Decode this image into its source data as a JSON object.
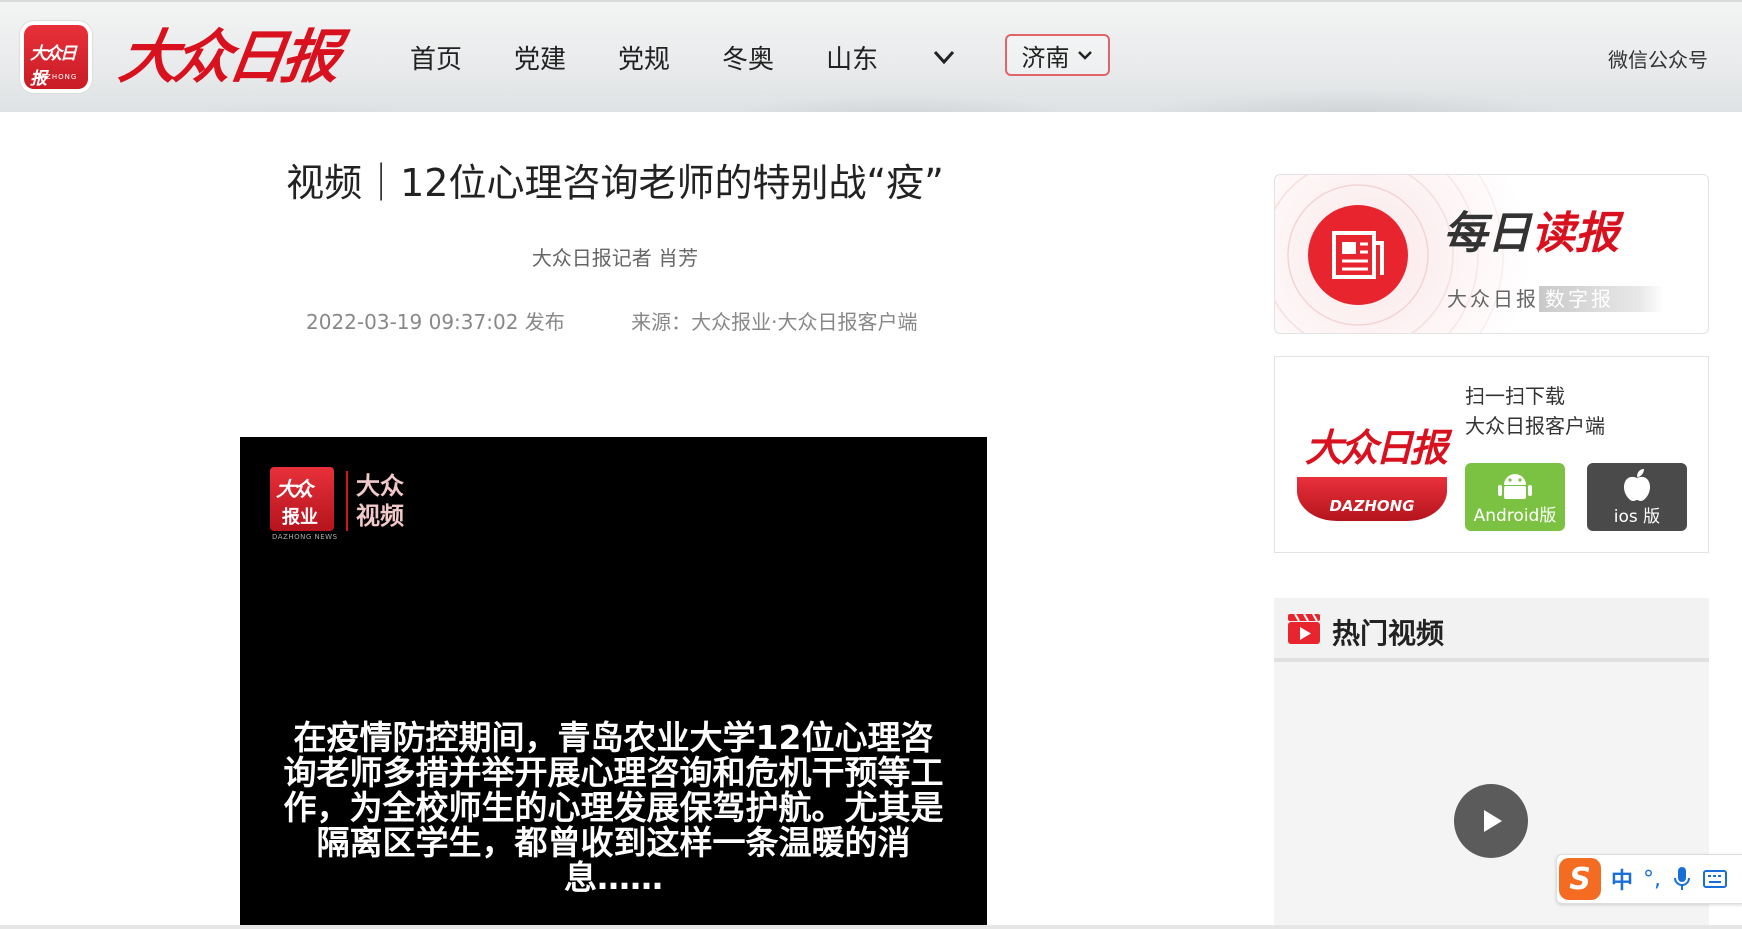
{
  "header": {
    "app_logo_text": "大众日报",
    "app_logo_sub": "DAZHONG",
    "brand": "大众日报",
    "nav": [
      "首页",
      "党建",
      "党规",
      "冬奥",
      "山东"
    ],
    "region": "济南",
    "wechat": "微信公众号"
  },
  "article": {
    "title": "视频｜12位心理咨询老师的特别战“疫”",
    "byline": "大众日报记者 肖芳",
    "published": "2022-03-19 09:37:02 发布",
    "source": "来源：大众报业·大众日报客户端"
  },
  "video": {
    "logo_top": "大众",
    "logo_bottom": "报业",
    "logo_caption": "DAZHONG NEWS",
    "channel": "大众视频",
    "subtitle": "在疫情防控期间，青岛农业大学12位心理咨询老师多措并举开展心理咨询和危机干预等工作，为全校师生的心理发展保驾护航。尤其是隔离区学生，都曾收到这样一条温暖的消息……"
  },
  "sidebar": {
    "daily": {
      "title_a": "每日",
      "title_b": "读报",
      "sub_a": "大众日报",
      "sub_b": "数字报"
    },
    "app": {
      "emblem": "大众日报",
      "emblem_ribbon": "DAZHONG",
      "scan_line1": "扫一扫下载",
      "scan_line2": "大众日报客户端",
      "android": "Android版",
      "ios": "ios 版"
    },
    "hot_videos": {
      "title": "热门视频"
    }
  },
  "ime": {
    "zh": "中",
    "punc": "°,"
  },
  "colors": {
    "brand_red": "#d9101e",
    "android_green": "#7cc242",
    "ios_gray": "#4a4a4a",
    "ime_orange": "#f36c21"
  }
}
